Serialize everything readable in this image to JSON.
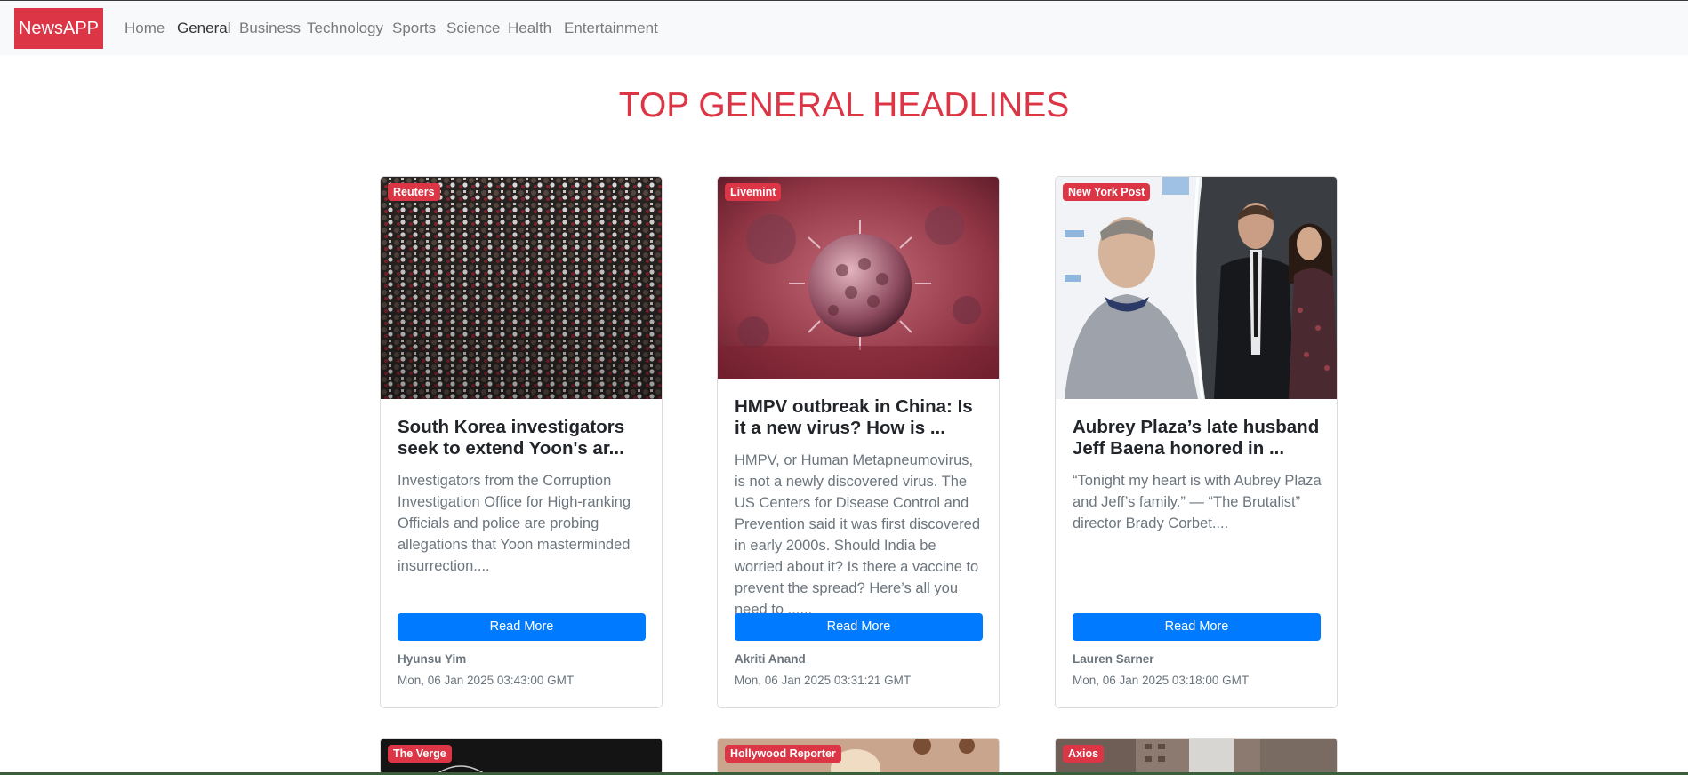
{
  "navbar": {
    "brand": "NewsAPP",
    "links": [
      "Home",
      "General",
      "Business",
      "Technology",
      "Sports",
      "Science",
      "Health",
      "Entertainment"
    ],
    "active": "General"
  },
  "page": {
    "heading": "TOP GENERAL HEADLINES"
  },
  "colors": {
    "brand": "#dc3545",
    "button": "#007bff",
    "navbar_bg": "#f8f9fa",
    "muted_text": "#6c757d"
  },
  "cards": [
    {
      "source": "Reuters",
      "title": "South Korea investigators seek to extend Yoon's ar...",
      "description": "Investigators from the Corruption Investigation Office for High-ranking Officials and police are probing allegations that Yoon masterminded insurrection....",
      "button": "Read More",
      "author": "Hyunsu Yim",
      "date": "Mon, 06 Jan 2025 03:43:00 GMT"
    },
    {
      "source": "Livemint",
      "title": "HMPV outbreak in China: Is it a new virus? How is ...",
      "description": "HMPV, or Human Metapneumovirus, is not a newly discovered virus. The US Centers for Disease Control and Prevention said it was first discovered in early 2000s. Should India be worried about it? Is there a vaccine to prevent the spread? Here’s all you need to ......",
      "button": "Read More",
      "author": "Akriti Anand",
      "date": "Mon, 06 Jan 2025 03:31:21 GMT"
    },
    {
      "source": "New York Post",
      "title": "Aubrey Plaza’s late husband Jeff Baena honored in ...",
      "description": "“Tonight my heart is with Aubrey Plaza and Jeff’s family.” — “The Brutalist” director Brady Corbet....",
      "button": "Read More",
      "author": "Lauren Sarner",
      "date": "Mon, 06 Jan 2025 03:18:00 GMT"
    },
    {
      "source": "The Verge"
    },
    {
      "source": "Hollywood Reporter"
    },
    {
      "source": "Axios"
    }
  ]
}
